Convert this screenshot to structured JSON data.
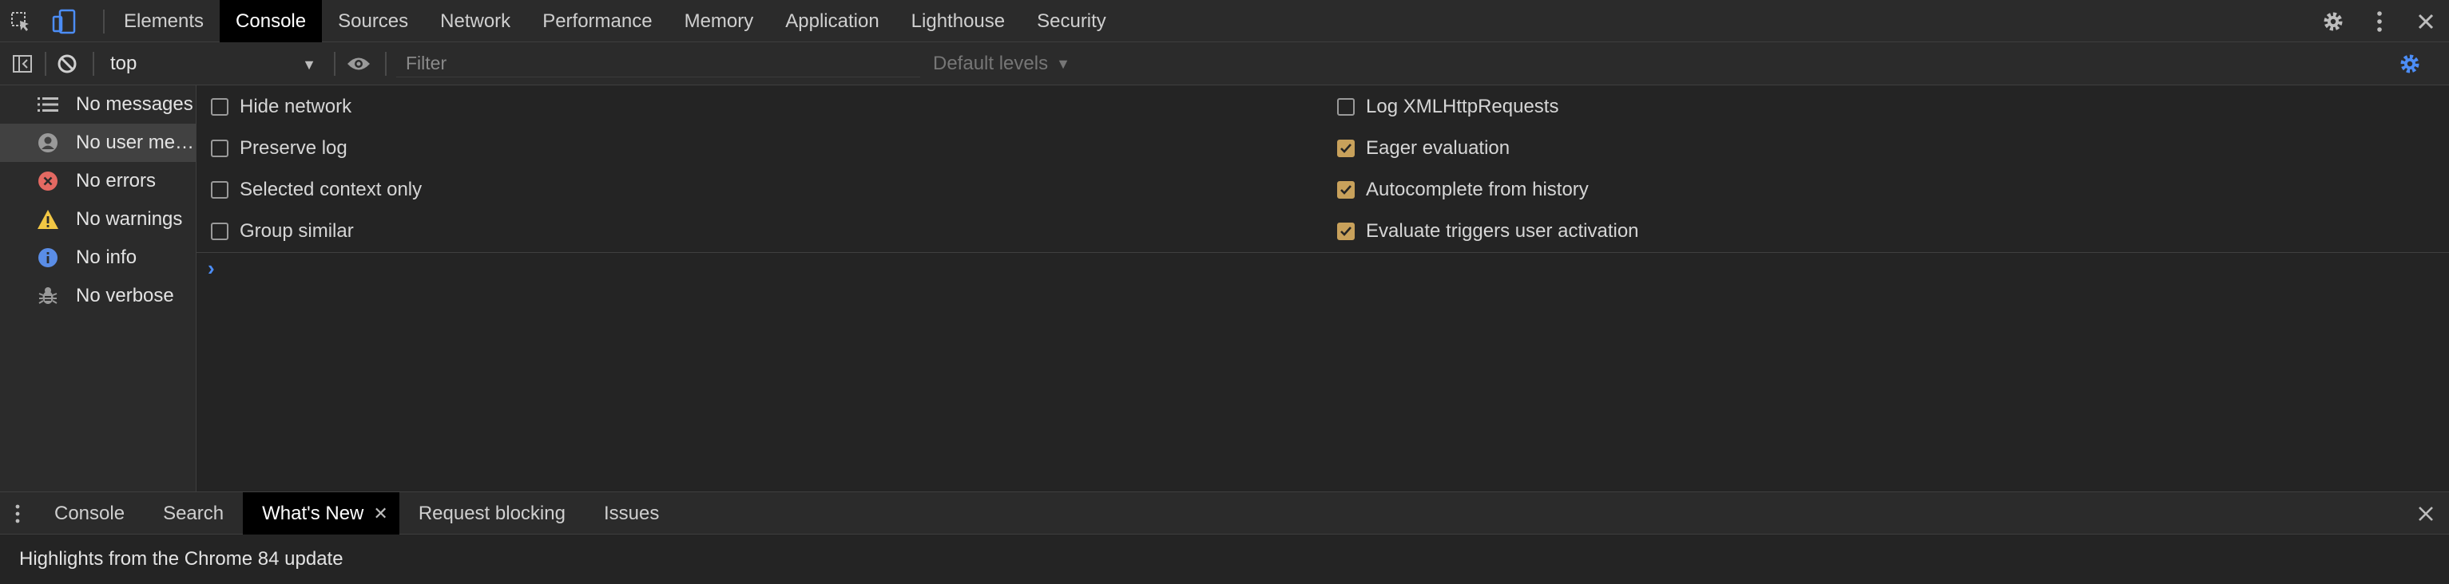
{
  "main_tabs": [
    {
      "label": "Elements"
    },
    {
      "label": "Console"
    },
    {
      "label": "Sources"
    },
    {
      "label": "Network"
    },
    {
      "label": "Performance"
    },
    {
      "label": "Memory"
    },
    {
      "label": "Application"
    },
    {
      "label": "Lighthouse"
    },
    {
      "label": "Security"
    }
  ],
  "active_main_tab": "Console",
  "toolbar": {
    "context": "top",
    "filter_placeholder": "Filter",
    "levels": "Default levels"
  },
  "sidebar": {
    "items": [
      {
        "label": "No messages",
        "icon": "list-icon"
      },
      {
        "label": "No user me…",
        "icon": "user-icon"
      },
      {
        "label": "No errors",
        "icon": "error-icon"
      },
      {
        "label": "No warnings",
        "icon": "warning-icon"
      },
      {
        "label": "No info",
        "icon": "info-icon"
      },
      {
        "label": "No verbose",
        "icon": "bug-icon"
      }
    ]
  },
  "settings": {
    "left": [
      {
        "label": "Hide network",
        "checked": false
      },
      {
        "label": "Preserve log",
        "checked": false
      },
      {
        "label": "Selected context only",
        "checked": false
      },
      {
        "label": "Group similar",
        "checked": false
      }
    ],
    "right": [
      {
        "label": "Log XMLHttpRequests",
        "checked": false
      },
      {
        "label": "Eager evaluation",
        "checked": true
      },
      {
        "label": "Autocomplete from history",
        "checked": true
      },
      {
        "label": "Evaluate triggers user activation",
        "checked": true
      }
    ]
  },
  "console_prompt": "›",
  "drawer": {
    "tabs": [
      {
        "label": "Console"
      },
      {
        "label": "Search"
      },
      {
        "label": "What's New"
      },
      {
        "label": "Request blocking"
      },
      {
        "label": "Issues"
      }
    ],
    "active_tab": "What's New",
    "content": "Highlights from the Chrome 84 update"
  },
  "colors": {
    "accent_blue": "#4c8df6",
    "checkbox_checked": "#c8a15b",
    "error_red": "#e46962",
    "warning_yellow": "#f2c744",
    "info_blue": "#5a8de6"
  }
}
